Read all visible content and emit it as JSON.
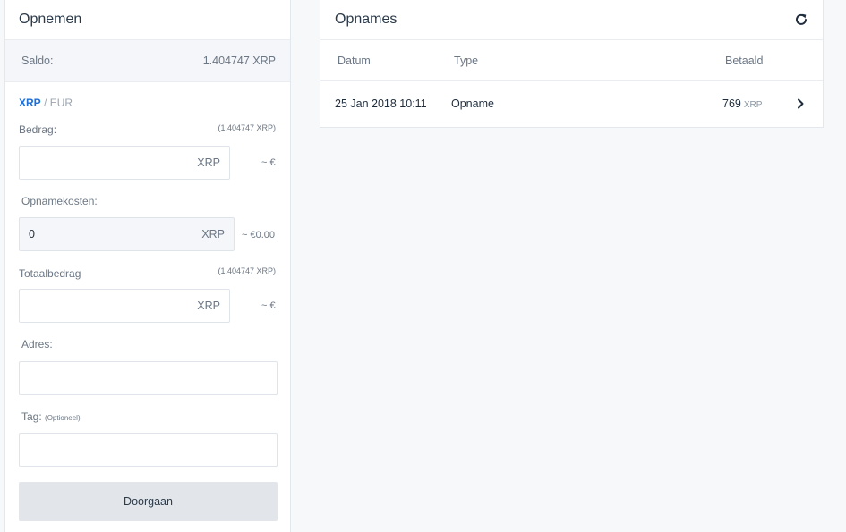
{
  "withdraw": {
    "title": "Opnemen",
    "balance_label": "Saldo:",
    "balance_value": "1.404747 XRP",
    "currency_active": "XRP",
    "currency_separator": "/",
    "currency_inactive": "EUR",
    "amount": {
      "label": "Bedrag:",
      "hint": "(1.404747 XRP)",
      "value": "",
      "unit": "XRP",
      "approx": "~ €"
    },
    "fee": {
      "label": "Opnamekosten:",
      "value": "0",
      "unit": "XRP",
      "approx": "~ €0.00"
    },
    "total": {
      "label": "Totaalbedrag",
      "hint": "(1.404747 XRP)",
      "value": "",
      "unit": "XRP",
      "approx": "~ €"
    },
    "address": {
      "label": "Adres:",
      "value": ""
    },
    "tag": {
      "label": "Tag:",
      "label_optional": "(Optioneel)",
      "value": ""
    },
    "submit_label": "Doorgaan"
  },
  "withdrawals": {
    "title": "Opnames",
    "columns": [
      "Datum",
      "Type",
      "Betaald"
    ],
    "rows": [
      {
        "date": "25 Jan 2018 10:11",
        "type": "Opname",
        "amount": "769",
        "unit": "XRP"
      }
    ]
  },
  "colors": {
    "accent": "#1d6fd6",
    "background": "#f6f8fa",
    "panel": "#ffffff",
    "button": "#e2e6eb"
  },
  "icons": {
    "refresh": "refresh-icon",
    "row_chevron": "chevron-right-icon"
  }
}
